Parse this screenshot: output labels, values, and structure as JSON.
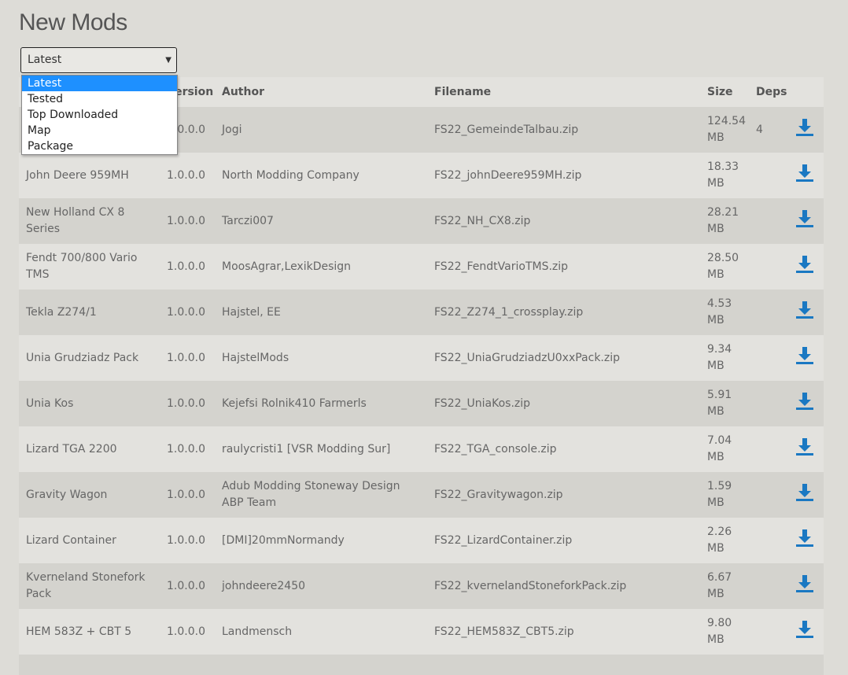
{
  "page": {
    "title": "New Mods"
  },
  "filter": {
    "selected": "Latest",
    "options": [
      "Latest",
      "Tested",
      "Top Downloaded",
      "Map",
      "Package"
    ]
  },
  "table": {
    "headers": {
      "name": "",
      "version": "Version",
      "author": "Author",
      "filename": "Filename",
      "size": "Size",
      "deps": "Deps"
    },
    "rows": [
      {
        "name": "",
        "version": "1.0.0.0",
        "author": "Jogi",
        "filename": "FS22_GemeindeTalbau.zip",
        "size_value": "124.54",
        "size_unit": "MB",
        "deps": "4"
      },
      {
        "name": "John Deere 959MH",
        "version": "1.0.0.0",
        "author": "North Modding Company",
        "filename": "FS22_johnDeere959MH.zip",
        "size_value": "18.33",
        "size_unit": "MB",
        "deps": ""
      },
      {
        "name": "New Holland CX 8 Series",
        "version": "1.0.0.0",
        "author": "Tarczi007",
        "filename": "FS22_NH_CX8.zip",
        "size_value": "28.21",
        "size_unit": "MB",
        "deps": ""
      },
      {
        "name": "Fendt 700/800 Vario TMS",
        "version": "1.0.0.0",
        "author": "MoosAgrar,LexikDesign",
        "filename": "FS22_FendtVarioTMS.zip",
        "size_value": "28.50",
        "size_unit": "MB",
        "deps": ""
      },
      {
        "name": "Tekla Z274/1",
        "version": "1.0.0.0",
        "author": "Hajstel, EE",
        "filename": "FS22_Z274_1_crossplay.zip",
        "size_value": "4.53",
        "size_unit": "MB",
        "deps": ""
      },
      {
        "name": "Unia Grudziadz Pack",
        "version": "1.0.0.0",
        "author": "HajstelMods",
        "filename": "FS22_UniaGrudziadzU0xxPack.zip",
        "size_value": "9.34",
        "size_unit": "MB",
        "deps": ""
      },
      {
        "name": "Unia Kos",
        "version": "1.0.0.0",
        "author": "Kejefsi Rolnik410 Farmerls",
        "filename": "FS22_UniaKos.zip",
        "size_value": "5.91",
        "size_unit": "MB",
        "deps": ""
      },
      {
        "name": "Lizard TGA 2200",
        "version": "1.0.0.0",
        "author": "raulycristi1 [VSR Modding Sur]",
        "filename": "FS22_TGA_console.zip",
        "size_value": "7.04",
        "size_unit": "MB",
        "deps": ""
      },
      {
        "name": "Gravity Wagon",
        "version": "1.0.0.0",
        "author": "Adub Modding Stoneway Design ABP Team",
        "filename": "FS22_Gravitywagon.zip",
        "size_value": "1.59",
        "size_unit": "MB",
        "deps": ""
      },
      {
        "name": "Lizard Container",
        "version": "1.0.0.0",
        "author": "[DMI]20mmNormandy",
        "filename": "FS22_LizardContainer.zip",
        "size_value": "2.26",
        "size_unit": "MB",
        "deps": ""
      },
      {
        "name": "Kverneland Stonefork Pack",
        "version": "1.0.0.0",
        "author": "johndeere2450",
        "filename": "FS22_kvernelandStoneforkPack.zip",
        "size_value": "6.67",
        "size_unit": "MB",
        "deps": ""
      },
      {
        "name": "HEM 583Z + CBT 5",
        "version": "1.0.0.0",
        "author": "Landmensch",
        "filename": "FS22_HEM583Z_CBT5.zip",
        "size_value": "9.80",
        "size_unit": "MB",
        "deps": ""
      }
    ]
  },
  "icons": {
    "download": "download-icon",
    "caret": "caret-down-icon"
  },
  "colors": {
    "accent": "#1a78c2",
    "highlight": "#1e90ff"
  }
}
